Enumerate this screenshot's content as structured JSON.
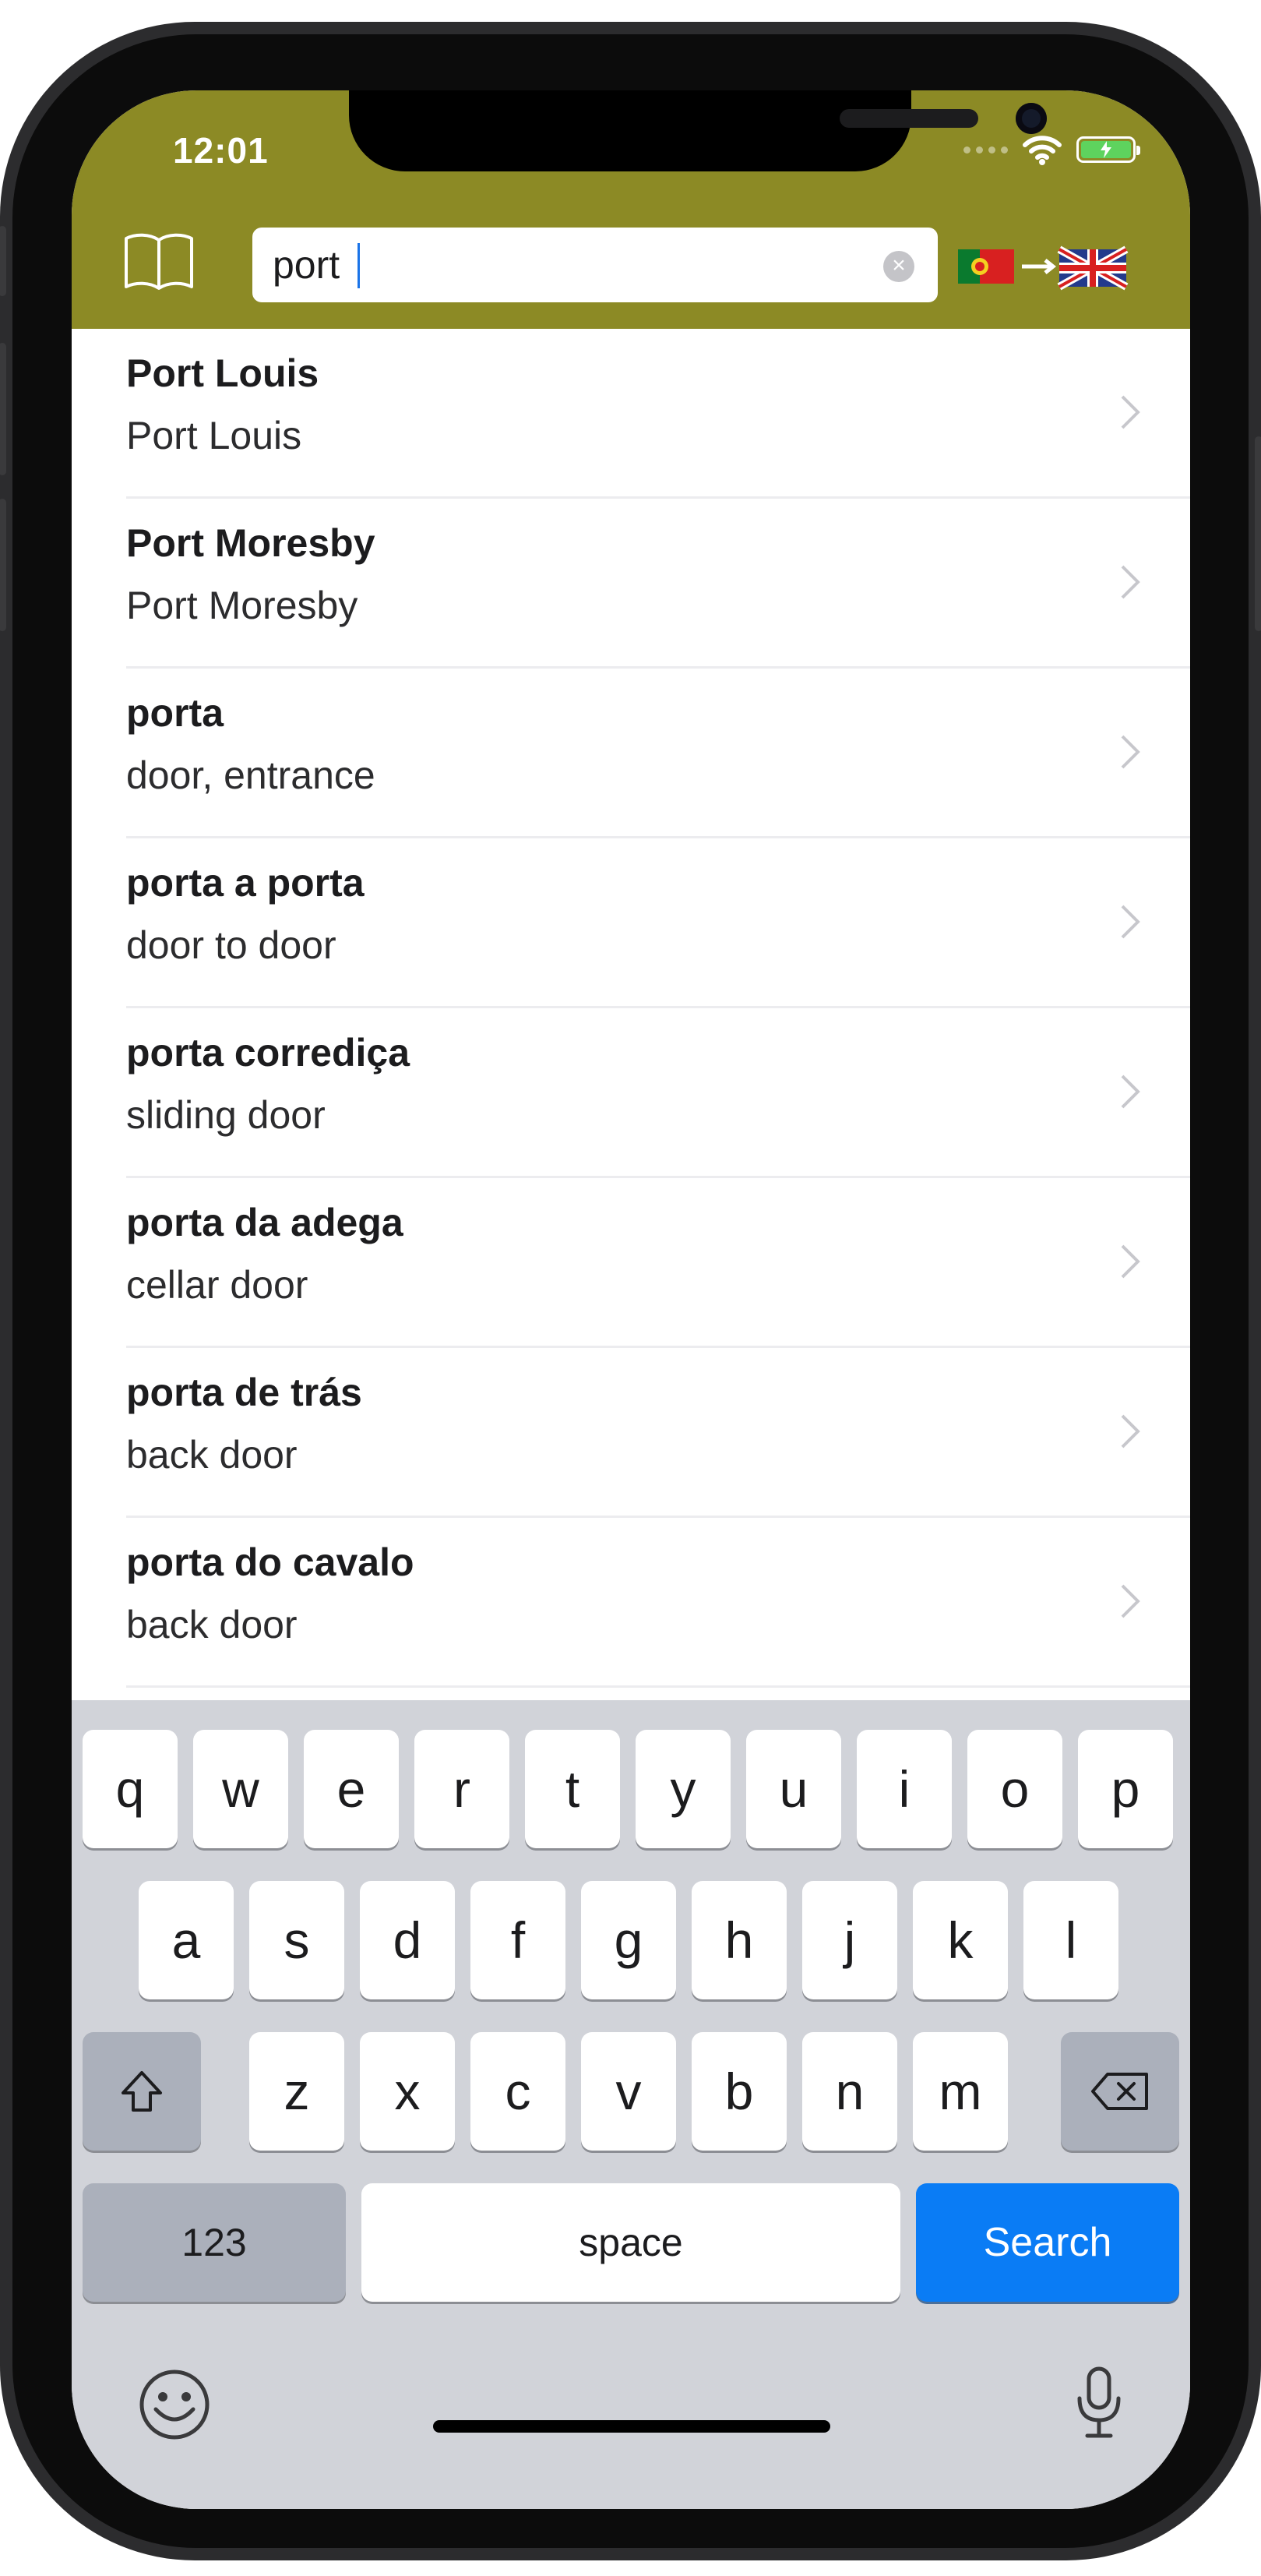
{
  "status_bar": {
    "time": "12:01"
  },
  "search": {
    "query": "port"
  },
  "results": [
    {
      "title": "Port Louis",
      "translation": "Port Louis"
    },
    {
      "title": "Port Moresby",
      "translation": "Port Moresby"
    },
    {
      "title": "porta",
      "translation": "door, entrance"
    },
    {
      "title": "porta a porta",
      "translation": "door to door"
    },
    {
      "title": "porta corrediça",
      "translation": "sliding door"
    },
    {
      "title": "porta da adega",
      "translation": "cellar door"
    },
    {
      "title": "porta de trás",
      "translation": "back door"
    },
    {
      "title": "porta do cavalo",
      "translation": "back door"
    }
  ],
  "keyboard": {
    "row1": [
      "q",
      "w",
      "e",
      "r",
      "t",
      "y",
      "u",
      "i",
      "o",
      "p"
    ],
    "row2": [
      "a",
      "s",
      "d",
      "f",
      "g",
      "h",
      "j",
      "k",
      "l"
    ],
    "row3": [
      "z",
      "x",
      "c",
      "v",
      "b",
      "n",
      "m"
    ],
    "numbers_key": "123",
    "space_key": "space",
    "search_key": "Search"
  },
  "icons": {
    "dictionary": "book-icon",
    "language_direction": "portugal-flag-arrow-uk-flag",
    "shift": "shift-icon",
    "delete": "backspace-icon",
    "emoji": "emoji-icon",
    "dictation": "microphone-icon"
  },
  "colors": {
    "header": "#8c8a25",
    "search_key": "#0a7cf5",
    "keyboard_bg": "#d1d3d9"
  }
}
